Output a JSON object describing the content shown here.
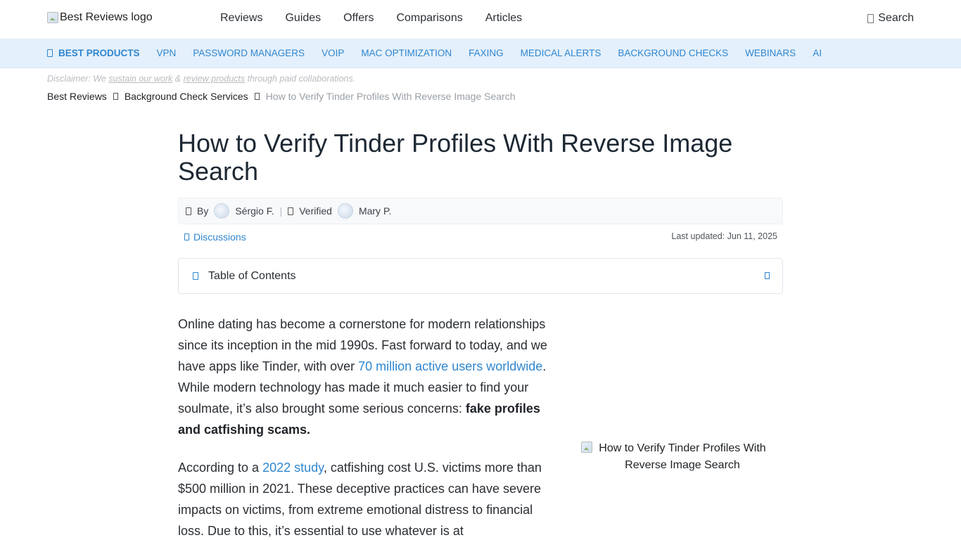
{
  "header": {
    "logo_alt": "Best Reviews logo",
    "nav": [
      "Reviews",
      "Guides",
      "Offers",
      "Comparisons",
      "Articles"
    ],
    "search_label": "Search"
  },
  "categories": {
    "best_label": "BEST PRODUCTS",
    "items": [
      "VPN",
      "PASSWORD MANAGERS",
      "VOIP",
      "MAC OPTIMIZATION",
      "FAXING",
      "MEDICAL ALERTS",
      "BACKGROUND CHECKS",
      "WEBINARS",
      "AI"
    ]
  },
  "disclaimer": {
    "prefix": "Disclaimer: We ",
    "link1": "sustain our work",
    "middle": " & ",
    "link2": "review products",
    "suffix": " through paid collaborations."
  },
  "breadcrumbs": [
    "Best Reviews",
    "Background Check Services",
    "How to Verify Tinder Profiles With Reverse Image Search"
  ],
  "article": {
    "title": "How to Verify Tinder Profiles With Reverse Image Search",
    "by_label": "By",
    "author": "Sérgio F.",
    "verified_label": "Verified",
    "verifier": "Mary P.",
    "discussions_label": "Discussions",
    "last_updated": "Last updated: Jun 11, 2025",
    "toc_label": "Table of Contents",
    "p1": {
      "t1": "Online dating has become a cornerstone for modern relationships since its inception in the mid 1990s. Fast forward to today, and we have apps like Tinder, with over ",
      "link": "70 million active users worldwide",
      "t2": ". While modern technology has made it much easier to find your soulmate, it’s also brought some serious concerns: ",
      "bold": "fake profiles and catfishing scams."
    },
    "p2": {
      "t1": "According to a ",
      "link": "2022 study",
      "t2": ", catfishing cost U.S. victims more than $500 million in 2021. These deceptive practices can have severe impacts on victims, from extreme emotional distress to financial loss. Due to this, it’s essential to use whatever is at"
    },
    "figure_alt": "How to Verify Tinder Profiles With Reverse Image Search"
  },
  "colors": {
    "accent": "#2f86cf",
    "category_bar": "#e4f0fb"
  },
  "icons": [
    "broken-image-icon",
    "search-icon",
    "star-icon",
    "chevron-right-icon",
    "user-icon",
    "check-icon",
    "comment-icon",
    "list-icon",
    "chevron-down-icon"
  ]
}
